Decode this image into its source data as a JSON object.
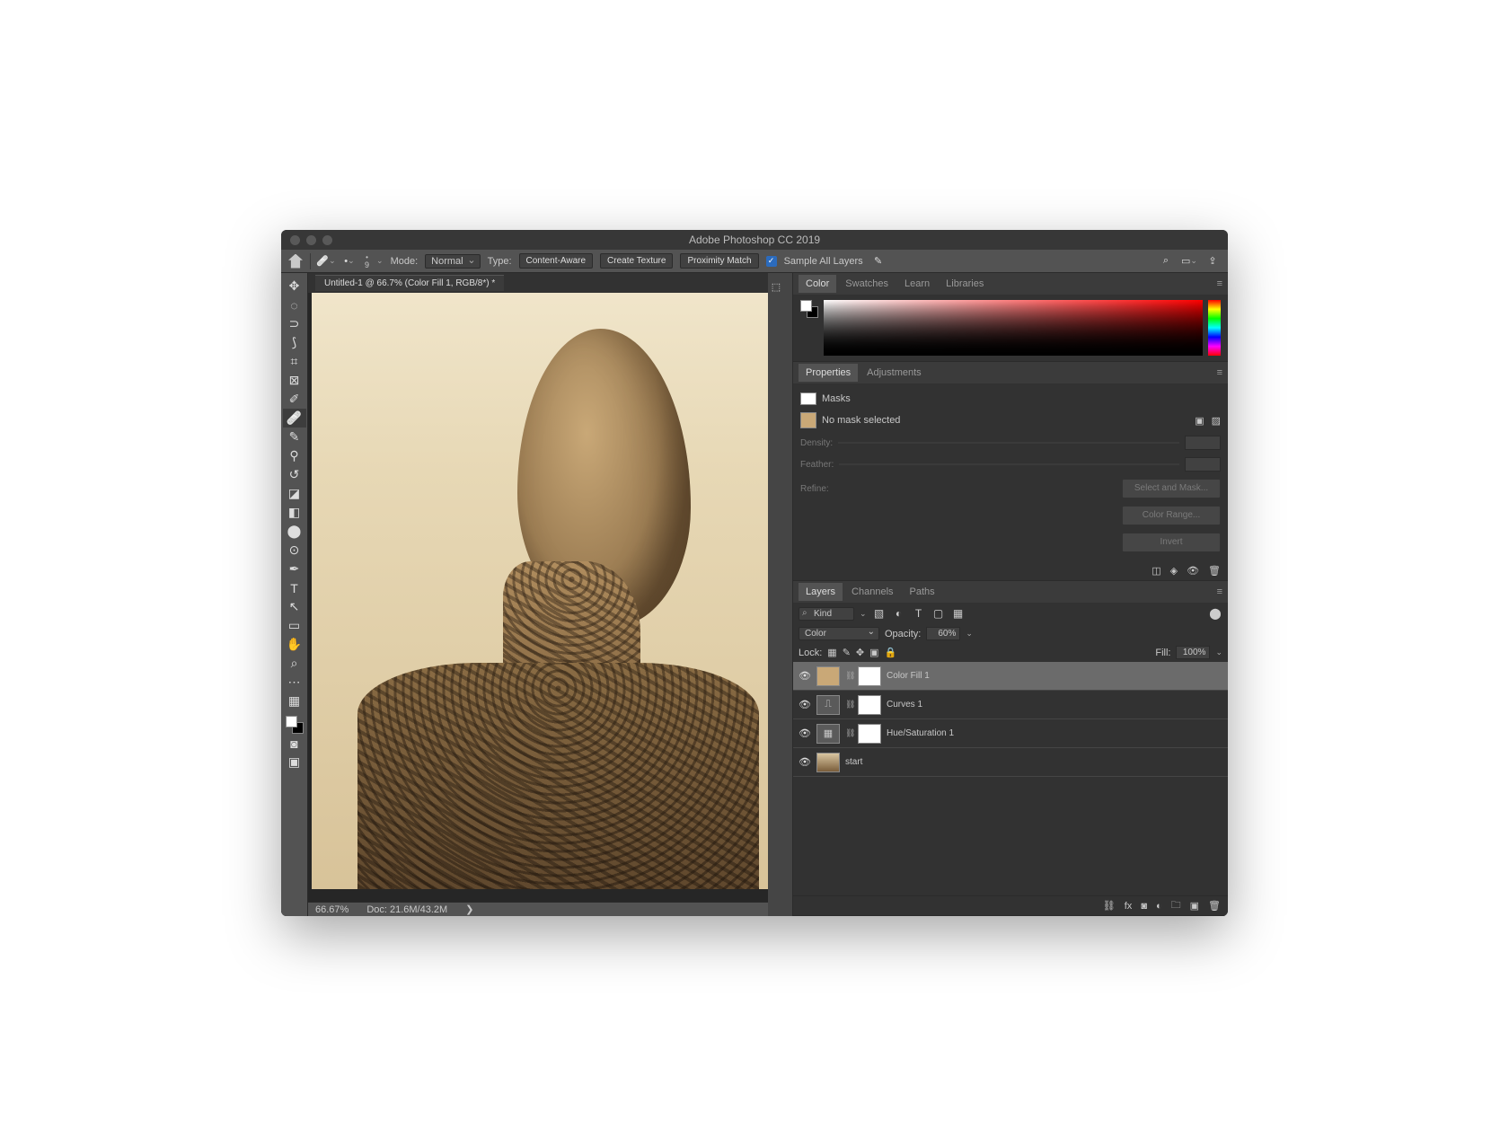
{
  "app_title": "Adobe Photoshop CC 2019",
  "options": {
    "brush_size": "9",
    "mode_label": "Mode:",
    "mode_value": "Normal",
    "type_label": "Type:",
    "btn_content_aware": "Content-Aware",
    "btn_create_texture": "Create Texture",
    "btn_proximity": "Proximity Match",
    "sample_all": "Sample All Layers"
  },
  "document": {
    "tab": "Untitled-1 @ 66.7% (Color Fill 1, RGB/8*) *",
    "zoom": "66.67%",
    "doc_size": "Doc: 21.6M/43.2M"
  },
  "panels": {
    "color": {
      "tabs": [
        "Color",
        "Swatches",
        "Learn",
        "Libraries"
      ]
    },
    "props": {
      "tabs": [
        "Properties",
        "Adjustments"
      ],
      "header": "Masks",
      "no_mask": "No mask selected",
      "density": "Density:",
      "feather": "Feather:",
      "refine": "Refine:",
      "select_mask": "Select and Mask...",
      "color_range": "Color Range...",
      "invert": "Invert"
    },
    "layers": {
      "tabs": [
        "Layers",
        "Channels",
        "Paths"
      ],
      "kind": "Kind",
      "blend": "Color",
      "opacity_label": "Opacity:",
      "opacity": "60%",
      "lock_label": "Lock:",
      "fill_label": "Fill:",
      "fill": "100%",
      "items": [
        {
          "name": "Color Fill 1",
          "type": "fill"
        },
        {
          "name": "Curves 1",
          "type": "curves"
        },
        {
          "name": "Hue/Saturation 1",
          "type": "hue"
        },
        {
          "name": "start",
          "type": "image"
        }
      ]
    }
  }
}
